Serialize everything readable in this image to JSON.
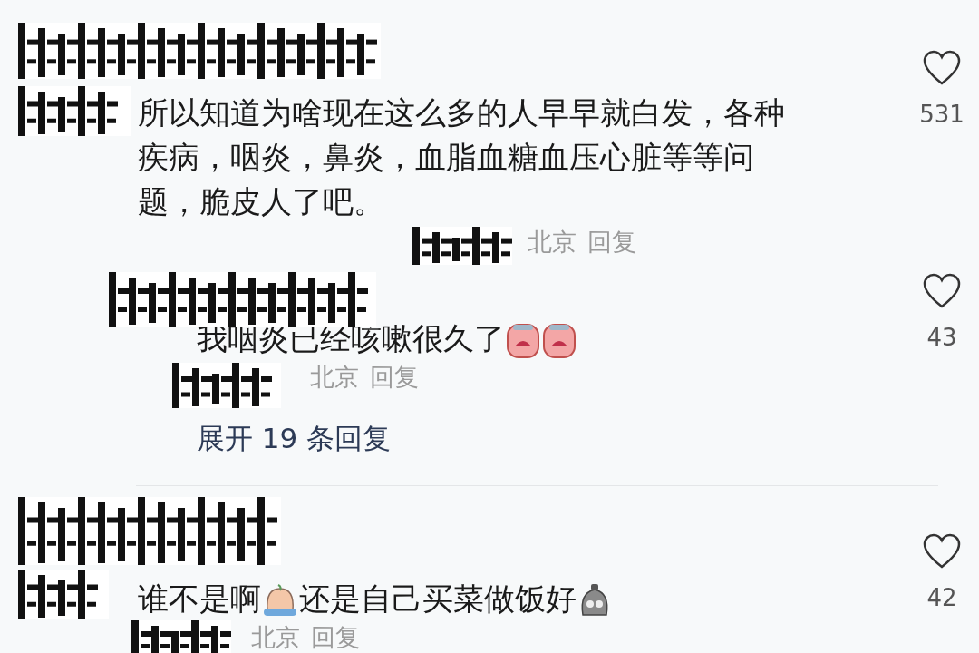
{
  "comments": [
    {
      "text": [
        {
          "kind": "text",
          "text": "所以知道为啥现在这么多的人早早就白发，各种疾病，咽炎，鼻炎，血脂血糖血压心脏等等问题，脆皮人了吧。"
        }
      ],
      "location": "北京",
      "reply_link": "回复",
      "liked": false,
      "likes": "531",
      "replies": [
        {
          "text": [
            {
              "kind": "text",
              "text": "我咽炎已经咳嗽很久了"
            },
            {
              "kind": "sob"
            },
            {
              "kind": "sob"
            }
          ],
          "location": "北京",
          "reply_link": "回复",
          "liked": false,
          "likes": "43"
        }
      ],
      "expand": "展开 19 条回复"
    },
    {
      "text": [
        {
          "kind": "text",
          "text": "谁不是啊"
        },
        {
          "kind": "cry"
        },
        {
          "kind": "text",
          "text": "还是自己买菜做饭好"
        },
        {
          "kind": "blob"
        }
      ],
      "location": "北京",
      "reply_link": "回复",
      "liked": false,
      "likes": "42"
    }
  ]
}
